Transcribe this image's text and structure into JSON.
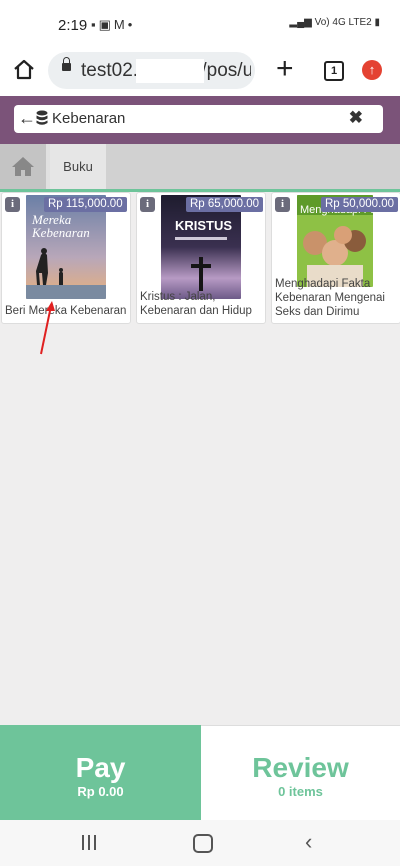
{
  "status_bar": {
    "time": "2:19",
    "icons": [
      "photo-icon",
      "gallery-icon",
      "gmail-icon",
      "dot-icon"
    ],
    "network_label": "Vo) 4G LTE2"
  },
  "browser": {
    "url": "test02.            /pos/u",
    "tab_count": "1"
  },
  "search": {
    "value": "Kebenaran",
    "placeholder": ""
  },
  "categories": {
    "active_tab": "Buku"
  },
  "products": [
    {
      "name": "Beri Mereka Kebenaran",
      "price": "Rp 115,000.00",
      "cover_title": "Mereka Kebenaran"
    },
    {
      "name": "Kristus : Jalan, Kebenaran dan Hidup",
      "price": "Rp 65,000.00",
      "cover_title": "KRISTUS"
    },
    {
      "name": "Menghadapi Fakta Kebenaran Mengenai Seks dan Dirimu",
      "price": "Rp 50,000.00",
      "cover_title": "Menghadapi Fakta"
    }
  ],
  "footer": {
    "pay_label": "Pay",
    "pay_amount": "Rp 0.00",
    "review_label": "Review",
    "review_count": "0 items"
  },
  "colors": {
    "accent_green": "#6ec49a",
    "header_purple": "#7b5379",
    "price_tag": "#6b6fa3",
    "annotation_arrow": "#e02020"
  }
}
